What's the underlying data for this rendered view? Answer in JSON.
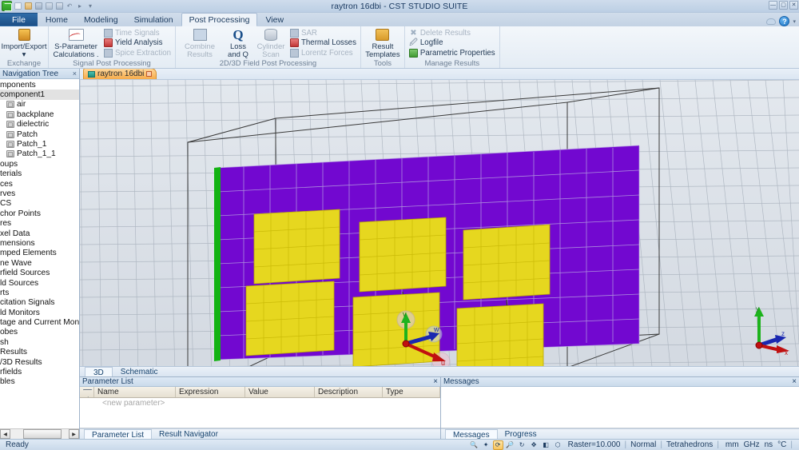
{
  "window": {
    "title": "raytron 16dbi - CST STUDIO SUITE",
    "minimize": "—",
    "maximize": "▢",
    "close": "✕",
    "quick_access": [
      "cst-logo",
      "new-icon",
      "open-icon",
      "save-icon",
      "save-as-icon",
      "print-icon",
      "undo-icon",
      "redo-icon",
      "customize-icon"
    ]
  },
  "ribbon": {
    "tabs": [
      {
        "label": "File",
        "active": false,
        "file": true
      },
      {
        "label": "Home",
        "active": false
      },
      {
        "label": "Modeling",
        "active": false
      },
      {
        "label": "Simulation",
        "active": false
      },
      {
        "label": "Post Processing",
        "active": true
      },
      {
        "label": "View",
        "active": false
      }
    ],
    "help_glyph": "?",
    "groups": [
      {
        "title": "Exchange",
        "big": [
          {
            "label": "Import/Export",
            "sublabel": "▾",
            "icon": "import-export-icon"
          }
        ],
        "small": []
      },
      {
        "title": "Signal Post Processing",
        "big": [
          {
            "label": "S-Parameter",
            "sublabel": "Calculations .",
            "icon": "s-parameter-icon"
          }
        ],
        "small": [
          {
            "label": "Time Signals",
            "icon": "time-signals-icon",
            "disabled": true
          },
          {
            "label": "Yield Analysis",
            "icon": "yield-analysis-icon",
            "disabled": false
          },
          {
            "label": "Spice Extraction",
            "icon": "spice-extraction-icon",
            "disabled": true
          }
        ]
      },
      {
        "title": "2D/3D Field Post Processing",
        "big": [
          {
            "label": "Combine",
            "sublabel": "Results",
            "icon": "combine-results-icon",
            "disabled": true
          },
          {
            "label": "Loss",
            "sublabel": "and Q",
            "icon": "loss-and-q-icon"
          },
          {
            "label": "Cylinder",
            "sublabel": "Scan",
            "icon": "cylinder-scan-icon",
            "disabled": true
          }
        ],
        "small": [
          {
            "label": "SAR",
            "icon": "sar-icon",
            "disabled": true
          },
          {
            "label": "Thermal Losses",
            "icon": "thermal-losses-icon",
            "disabled": false
          },
          {
            "label": "Lorentz Forces",
            "icon": "lorentz-forces-icon",
            "disabled": true
          }
        ]
      },
      {
        "title": "Tools",
        "big": [
          {
            "label": "Result",
            "sublabel": "Templates",
            "icon": "result-templates-icon"
          }
        ],
        "small": []
      },
      {
        "title": "Manage Results",
        "big": [],
        "small": [
          {
            "label": "Delete Results",
            "icon": "delete-results-icon",
            "disabled": true
          },
          {
            "label": "Logfile",
            "icon": "logfile-icon",
            "disabled": false
          },
          {
            "label": "Parametric Properties",
            "icon": "parametric-properties-icon",
            "disabled": false
          }
        ]
      }
    ]
  },
  "navigation": {
    "caption": "Navigation Tree",
    "close_glyph": "×",
    "items": [
      {
        "label": "mponents",
        "type": "folder",
        "selected": false,
        "indent": 0
      },
      {
        "label": "component1",
        "type": "folder",
        "selected": true,
        "indent": 0
      },
      {
        "label": "air",
        "type": "solid",
        "selected": false,
        "indent": 1
      },
      {
        "label": "backplane",
        "type": "solid",
        "selected": false,
        "indent": 1
      },
      {
        "label": "dielectric",
        "type": "solid",
        "selected": false,
        "indent": 1
      },
      {
        "label": "Patch",
        "type": "solid",
        "selected": false,
        "indent": 1
      },
      {
        "label": "Patch_1",
        "type": "solid",
        "selected": false,
        "indent": 1
      },
      {
        "label": "Patch_1_1",
        "type": "solid",
        "selected": false,
        "indent": 1
      },
      {
        "label": "oups",
        "type": "folder",
        "selected": false,
        "indent": 0
      },
      {
        "label": "terials",
        "type": "folder",
        "selected": false,
        "indent": 0
      },
      {
        "label": "ces",
        "type": "folder",
        "selected": false,
        "indent": 0
      },
      {
        "label": "rves",
        "type": "folder",
        "selected": false,
        "indent": 0
      },
      {
        "label": "CS",
        "type": "folder",
        "selected": false,
        "indent": 0
      },
      {
        "label": "chor Points",
        "type": "folder",
        "selected": false,
        "indent": 0
      },
      {
        "label": "res",
        "type": "folder",
        "selected": false,
        "indent": 0
      },
      {
        "label": "xel Data",
        "type": "folder",
        "selected": false,
        "indent": 0
      },
      {
        "label": "mensions",
        "type": "folder",
        "selected": false,
        "indent": 0
      },
      {
        "label": "mped Elements",
        "type": "folder",
        "selected": false,
        "indent": 0
      },
      {
        "label": "ne Wave",
        "type": "folder",
        "selected": false,
        "indent": 0
      },
      {
        "label": "rfield Sources",
        "type": "folder",
        "selected": false,
        "indent": 0
      },
      {
        "label": "ld Sources",
        "type": "folder",
        "selected": false,
        "indent": 0
      },
      {
        "label": "rts",
        "type": "folder",
        "selected": false,
        "indent": 0
      },
      {
        "label": "citation Signals",
        "type": "folder",
        "selected": false,
        "indent": 0
      },
      {
        "label": "ld Monitors",
        "type": "folder",
        "selected": false,
        "indent": 0
      },
      {
        "label": "tage and Current Monito",
        "type": "folder",
        "selected": false,
        "indent": 0
      },
      {
        "label": "obes",
        "type": "folder",
        "selected": false,
        "indent": 0
      },
      {
        "label": "sh",
        "type": "folder",
        "selected": false,
        "indent": 0
      },
      {
        "label": "Results",
        "type": "folder",
        "selected": false,
        "indent": 0
      },
      {
        "label": "/3D Results",
        "type": "folder",
        "selected": false,
        "indent": 0
      },
      {
        "label": "rfields",
        "type": "folder",
        "selected": false,
        "indent": 0
      },
      {
        "label": "bles",
        "type": "folder",
        "selected": false,
        "indent": 0
      }
    ]
  },
  "document": {
    "tab_label": "raytron 16dbi",
    "tab_close": "□"
  },
  "viewport": {
    "view_tabs": [
      {
        "label": "3D",
        "active": true
      },
      {
        "label": "Schematic",
        "active": false
      }
    ],
    "model": {
      "substrate_color": "#7208d0",
      "patch_color": "#e6d71f",
      "edge_color": "#13b313",
      "patch_count": 6,
      "patch_rows": 2,
      "patch_cols": 3
    },
    "axis_triad": {
      "x": "x",
      "y": "y",
      "z": "z"
    },
    "wcs_labels": {
      "u": "u",
      "v": "v",
      "w": "w"
    }
  },
  "parameter_dock": {
    "caption": "Parameter List",
    "close_glyph": "×",
    "columns": [
      "Name",
      "Expression",
      "Value",
      "Description",
      "Type"
    ],
    "new_row_placeholder": "<new parameter>",
    "rows": [],
    "tabs": [
      {
        "label": "Parameter List",
        "active": true
      },
      {
        "label": "Result Navigator",
        "active": false
      }
    ]
  },
  "messages_dock": {
    "caption": "Messages",
    "close_glyph": "×",
    "body": "",
    "tabs": [
      {
        "label": "Messages",
        "active": true
      },
      {
        "label": "Progress",
        "active": false
      }
    ]
  },
  "statusbar": {
    "status": "Ready",
    "icons": [
      "zoom-icon",
      "sparkle-icon",
      "rotate-icon",
      "zoom-in-icon",
      "refresh-icon",
      "move-icon",
      "pick-icon",
      "bbox-icon"
    ],
    "raster": "Raster=10.000",
    "mode": "Normal",
    "mesh_type": "Tetrahedrons",
    "units": [
      "mm",
      "GHz",
      "ns",
      "°C"
    ]
  }
}
